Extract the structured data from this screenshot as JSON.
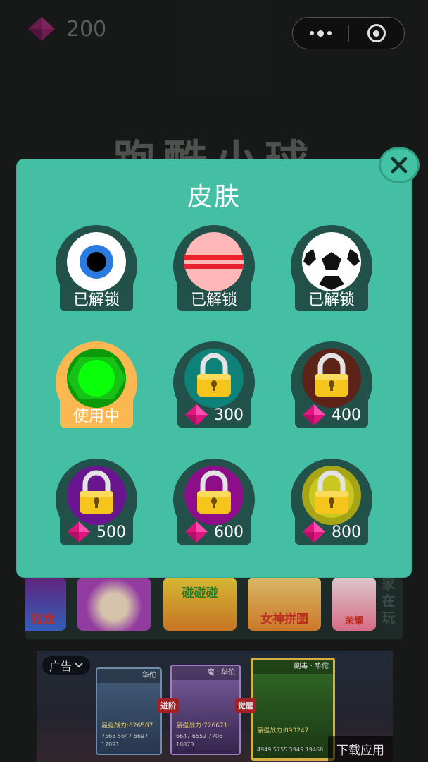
{
  "top_bar": {
    "gem_count": "200",
    "capsule": {
      "more_icon": "more-dots-icon",
      "close_icon": "target-circle-icon"
    }
  },
  "background_title": "跑酷小球",
  "games_strip": {
    "items": [
      {
        "caption": "指龙"
      },
      {
        "caption": ""
      },
      {
        "caption": "碰碰碰"
      },
      {
        "caption": "女神拼图"
      },
      {
        "caption": "荣耀"
      }
    ],
    "side_tag": "家在玩"
  },
  "ad": {
    "label": "广告",
    "cards": [
      {
        "header": "华佗",
        "power": "最强战力:626587",
        "stats": "7568  5647  6697  17891"
      },
      {
        "header": "魔 · 华佗",
        "power": "最强战力:726671",
        "stats": "6647  6552  7706  18873"
      },
      {
        "header": "剧毒 · 华佗",
        "power": "最强战力:893247",
        "stats": "4949  5755  5949  19468"
      }
    ],
    "arrow_1": "进阶",
    "arrow_2": "觉醒",
    "download_label": "下载应用"
  },
  "modal": {
    "title": "皮肤",
    "close_icon": "close-x-icon",
    "skins": [
      {
        "id": "eye",
        "state": "unlocked",
        "label": "已解锁",
        "ball_color": "#ffffff"
      },
      {
        "id": "stripe",
        "state": "unlocked",
        "label": "已解锁",
        "ball_color": "#ffb7b7"
      },
      {
        "id": "soccer",
        "state": "unlocked",
        "label": "已解锁",
        "ball_color": "#ffffff"
      },
      {
        "id": "green",
        "state": "in_use",
        "label": "使用中",
        "ball_color": "#16c216"
      },
      {
        "id": "teal",
        "state": "locked",
        "price": "300",
        "ball_color": "#0e8178"
      },
      {
        "id": "brown",
        "state": "locked",
        "price": "400",
        "ball_color": "#5e2318"
      },
      {
        "id": "purple",
        "state": "locked",
        "price": "500",
        "ball_color": "#6a1590"
      },
      {
        "id": "magenta",
        "state": "locked",
        "price": "600",
        "ball_color": "#8e0e8a"
      },
      {
        "id": "olive",
        "state": "locked",
        "price": "800",
        "ball_color": "#a7a516"
      }
    ]
  },
  "colors": {
    "modal_bg": "#45bfa3",
    "tile_dark": "#22514a",
    "tile_in_use": "#fbb850",
    "gem": "#e01580"
  }
}
